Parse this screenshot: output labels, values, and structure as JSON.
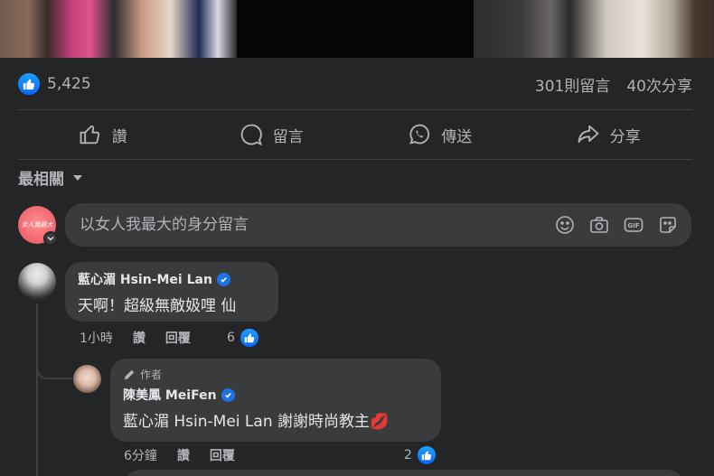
{
  "post": {
    "like_count": "5,425",
    "comments_count": "301則留言",
    "shares_count": "40次分享"
  },
  "actions": {
    "like": "讚",
    "comment": "留言",
    "send": "傳送",
    "share": "分享"
  },
  "sort": {
    "label": "最相關"
  },
  "composer": {
    "placeholder": "以女人我最大的身分留言",
    "avatar_text": "女人我最大"
  },
  "comments": [
    {
      "author": "藍心湄 Hsin-Mei Lan",
      "verified": true,
      "text": "天啊！超級無敵㚫哩 仙",
      "time": "1小時",
      "like_label": "讚",
      "reply_label": "回覆",
      "reactions": "6",
      "replies": [
        {
          "author_tag": "作者",
          "author": "陳美鳳 MeiFen",
          "verified": true,
          "mention": "藍心湄 Hsin-Mei Lan",
          "text": "謝謝時尚教主💋",
          "time": "6分鐘",
          "like_label": "讚",
          "reply_label": "回覆",
          "reactions": "2"
        }
      ]
    }
  ],
  "colors": {
    "background": "#242526",
    "surface": "#3a3b3c",
    "text_primary": "#e4e6eb",
    "text_secondary": "#b0b3b8",
    "accent": "#0866ff"
  }
}
